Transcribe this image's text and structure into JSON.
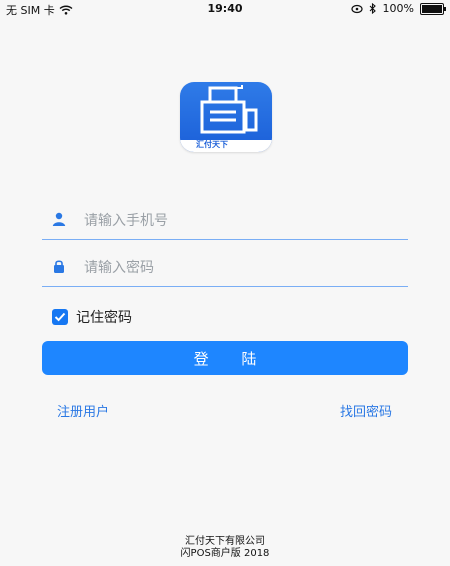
{
  "status_bar": {
    "carrier": "无 SIM 卡",
    "time": "19:40",
    "battery": "100%"
  },
  "logo": {
    "text": "汇付天下"
  },
  "login": {
    "phone_placeholder": "请输入手机号",
    "password_placeholder": "请输入密码",
    "remember_label": "记住密码",
    "remember_checked": true,
    "login_button": "登 陆",
    "register_link": "注册用户",
    "forgot_link": "找回密码"
  },
  "footer": {
    "company": "汇付天下有限公司",
    "version": "闪POS商户版 2018"
  },
  "colors": {
    "primary": "#1e86ff",
    "link": "#2a78e4",
    "underline": "#7aaef5",
    "background": "#f7f7f7"
  }
}
